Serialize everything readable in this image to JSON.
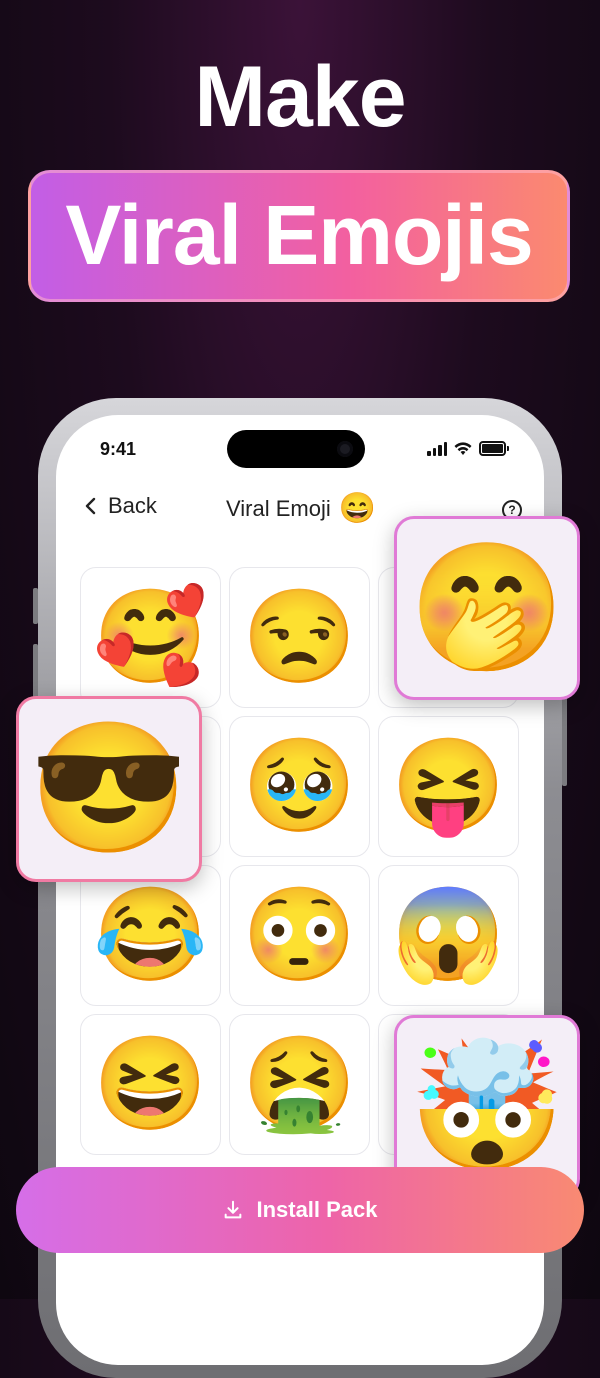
{
  "headline": {
    "line1": "Make",
    "line2": "Viral Emojis"
  },
  "status_bar": {
    "time": "9:41"
  },
  "nav": {
    "back_label": "Back",
    "title": "Viral Emoji",
    "title_emoji": "😄"
  },
  "grid": {
    "emojis": [
      "🥰",
      "😒",
      "🤭",
      "😎",
      "🥹",
      "😝",
      "😂",
      "😳",
      "😱",
      "😆",
      "🤮",
      "🤯"
    ]
  },
  "floating": {
    "top_right": "🤭",
    "left": "😎",
    "bottom_right": "🤯"
  },
  "install_button": {
    "label": "Install Pack",
    "icon": "download-icon"
  },
  "colors": {
    "pill_gradient_start": "#c25ee6",
    "pill_gradient_end": "#fb8a6f",
    "background": "#1d0b1e"
  }
}
